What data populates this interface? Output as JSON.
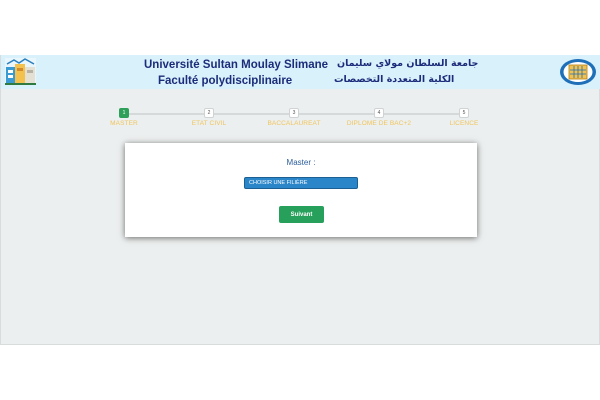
{
  "header": {
    "university_fr": "Université Sultan Moulay Slimane",
    "faculty_fr": "Faculté polydisciplinaire",
    "university_ar": "جامعة السلطان مولاي سليمان",
    "faculty_ar": "الكلية المتعددة التخصصات"
  },
  "stepper": {
    "current_step": 1,
    "steps": [
      {
        "number": "1",
        "label": "MASTER"
      },
      {
        "number": "2",
        "label": "ETAT CIVIL"
      },
      {
        "number": "3",
        "label": "BACCALAUREAT"
      },
      {
        "number": "4",
        "label": "DIPLOME DE BAC+2"
      },
      {
        "number": "5",
        "label": "LICENCE"
      }
    ]
  },
  "form": {
    "label": "Master :",
    "select_value": "CHOISIR UNE FILIÈRE",
    "next_button": "Suivant"
  },
  "colors": {
    "header_bg": "#d8f1fb",
    "title_text": "#1d2c7a",
    "active_step": "#2ea05a",
    "step_label": "#f0c55c",
    "select_bg": "#2b86c9",
    "button_bg": "#27a05b"
  },
  "icons": {
    "left_logo": "faculty-logo-icon",
    "right_logo": "university-emblem-icon"
  }
}
